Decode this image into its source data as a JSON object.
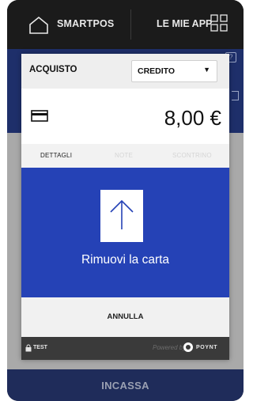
{
  "topbar": {
    "brand": "SMARTPOS",
    "apps_label": "LE MIE APP",
    "home_icon": "home-icon",
    "apps_icon": "grid-icon"
  },
  "dialog": {
    "title": "ACQUISTO",
    "select": {
      "value": "CREDITO",
      "caret": "▼"
    },
    "amount": "8,00 €",
    "tabs": [
      {
        "label": "DETTAGLI",
        "active": true
      },
      {
        "label": "NOTE",
        "active": false
      },
      {
        "label": "SCONTRINO",
        "active": false
      }
    ],
    "message": "Rimuovi la carta",
    "cancel_label": "ANNULLA",
    "footer": {
      "mode_label": "TEST",
      "powered_label": "Powered by",
      "brand_label": "POYNT"
    }
  },
  "bottom": {
    "incassa_label": "INCASSA"
  },
  "colors": {
    "blue_panel": "#2542b6",
    "topbar": "#1b1b1b",
    "bottom_bar": "#1f2c5a"
  }
}
